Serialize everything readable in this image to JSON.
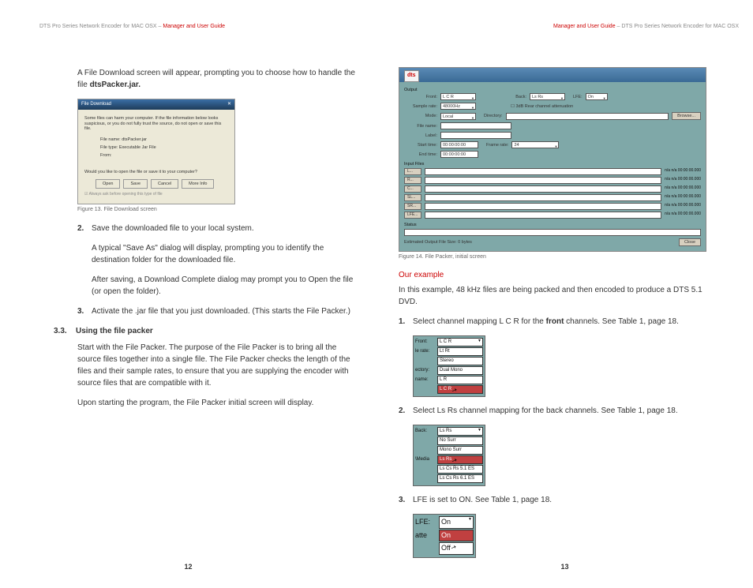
{
  "header": {
    "left_product": "DTS Pro Series Network Encoder for MAC OSX",
    "left_title": "Manager and User Guide",
    "right_title": "Manager and User Guide",
    "right_product": "DTS Pro Series Network Encoder for MAC OSX",
    "sep": " – "
  },
  "page12": {
    "intro": "A File Download screen will appear, prompting you to choose how to handle the file ",
    "intro_bold": "dtsPacker.jar.",
    "fig13": {
      "title": "File Download",
      "warn": "Some files can harm your computer. If the file information below looks suspicious, or you do not fully trust the source, do not open or save this file.",
      "filename_lbl": "File name:",
      "filename": "dtsPacker.jar",
      "filetype_lbl": "File type:",
      "filetype": "Executable Jar File",
      "from_lbl": "From:",
      "question": "Would you like to open the file or save it to your computer?",
      "btn_open": "Open",
      "btn_save": "Save",
      "btn_cancel": "Cancel",
      "btn_more": "More Info",
      "check": "Always ask before opening this type of file"
    },
    "caption13": "Figure 13. File Download screen",
    "step2_num": "2.",
    "step2": "Save the downloaded file to your local system.",
    "step2_p1": "A typical \"Save As\" dialog will display, prompting you to identify the destination folder for the downloaded file.",
    "step2_p2": "After saving, a Download Complete dialog may prompt you to Open the file (or open the folder).",
    "step3_num": "3.",
    "step3": "Activate the .jar file that you just downloaded. (This starts the File Packer.)",
    "section_num": "3.3.",
    "section_title": "Using the file packer",
    "section_p1": "Start with the File Packer. The purpose of the File Packer is to bring all the source files together into a single file. The File Packer checks the length of the files and their sample rates, to ensure that you are supplying the encoder with source files that are compatible with it.",
    "section_p2": "Upon starting the program, the File Packer initial screen will display.",
    "page_num": "12"
  },
  "page13": {
    "fig14": {
      "logo": "dts",
      "output": "Output",
      "front_lbl": "Front:",
      "front_val": "L C R",
      "back_lbl": "Back:",
      "back_val": "Ls Rs",
      "lfe_lbl": "LFE:",
      "lfe_val": "On",
      "sample_lbl": "Sample rate:",
      "sample_val": "48000Hz",
      "atten": "3dB Rear channel attenuation",
      "mode_lbl": "Mode:",
      "mode_val": "Local",
      "dir_lbl": "Directory:",
      "browse": "Browse...",
      "filename_lbl": "File name:",
      "label_lbl": "Label:",
      "start_lbl": "Start time:",
      "start_val": "00:00:00:00",
      "frame_lbl": "Frame rate:",
      "frame_val": "24",
      "end_lbl": "End time:",
      "end_val": "00:00:00:00",
      "input_files": "Input Files",
      "btns": [
        "L...",
        "R...",
        "C...",
        "SL...",
        "SR...",
        "LFE..."
      ],
      "meta": "n/a  n/a  00:00:00.000",
      "status": "Status",
      "est": "Estimated Output File Size: 0 bytes",
      "close": "Close"
    },
    "caption14": "Figure 14. File Packer, initial screen",
    "our_example": "Our example",
    "example_text": "In this example, 48 kHz files are being packed and then encoded to produce a DTS 5.1 DVD.",
    "s1_num": "1.",
    "s1_a": "Select channel mapping L C R for the ",
    "s1_bold": "front",
    "s1_b": " channels. See Table 1, page 18.",
    "mini1": {
      "r1l": "Front:",
      "r1v": "L C R",
      "r2l": "le rate:",
      "r2v": "Lt Rt",
      "r3l": "",
      "r3v": "Stereo",
      "r4l": "ectory:",
      "r4v": "Dual Mono",
      "r5l": "name:",
      "r5v": "L R",
      "r6v": "L C R"
    },
    "s2_num": "2.",
    "s2": "Select Ls Rs channel mapping for the back channels. See Table 1, page 18.",
    "mini2": {
      "r1l": "Back:",
      "r1v": "Ls Rs",
      "r2v": "No Surr",
      "r3v": "Mono Surr",
      "r4l": "\\Media",
      "r4v": "Ls Rs",
      "r5v": "Ls Cs Rs 5.1 ES",
      "r6v": "Ls Cs Rs 6.1 ES"
    },
    "s3_num": "3.",
    "s3": "LFE is set to ON. See Table 1, page 18.",
    "mini3": {
      "r1l": "LFE:",
      "r1v": "On",
      "r2l": "atte",
      "r2v": "On",
      "r3v": "Off"
    },
    "page_num": "13"
  }
}
